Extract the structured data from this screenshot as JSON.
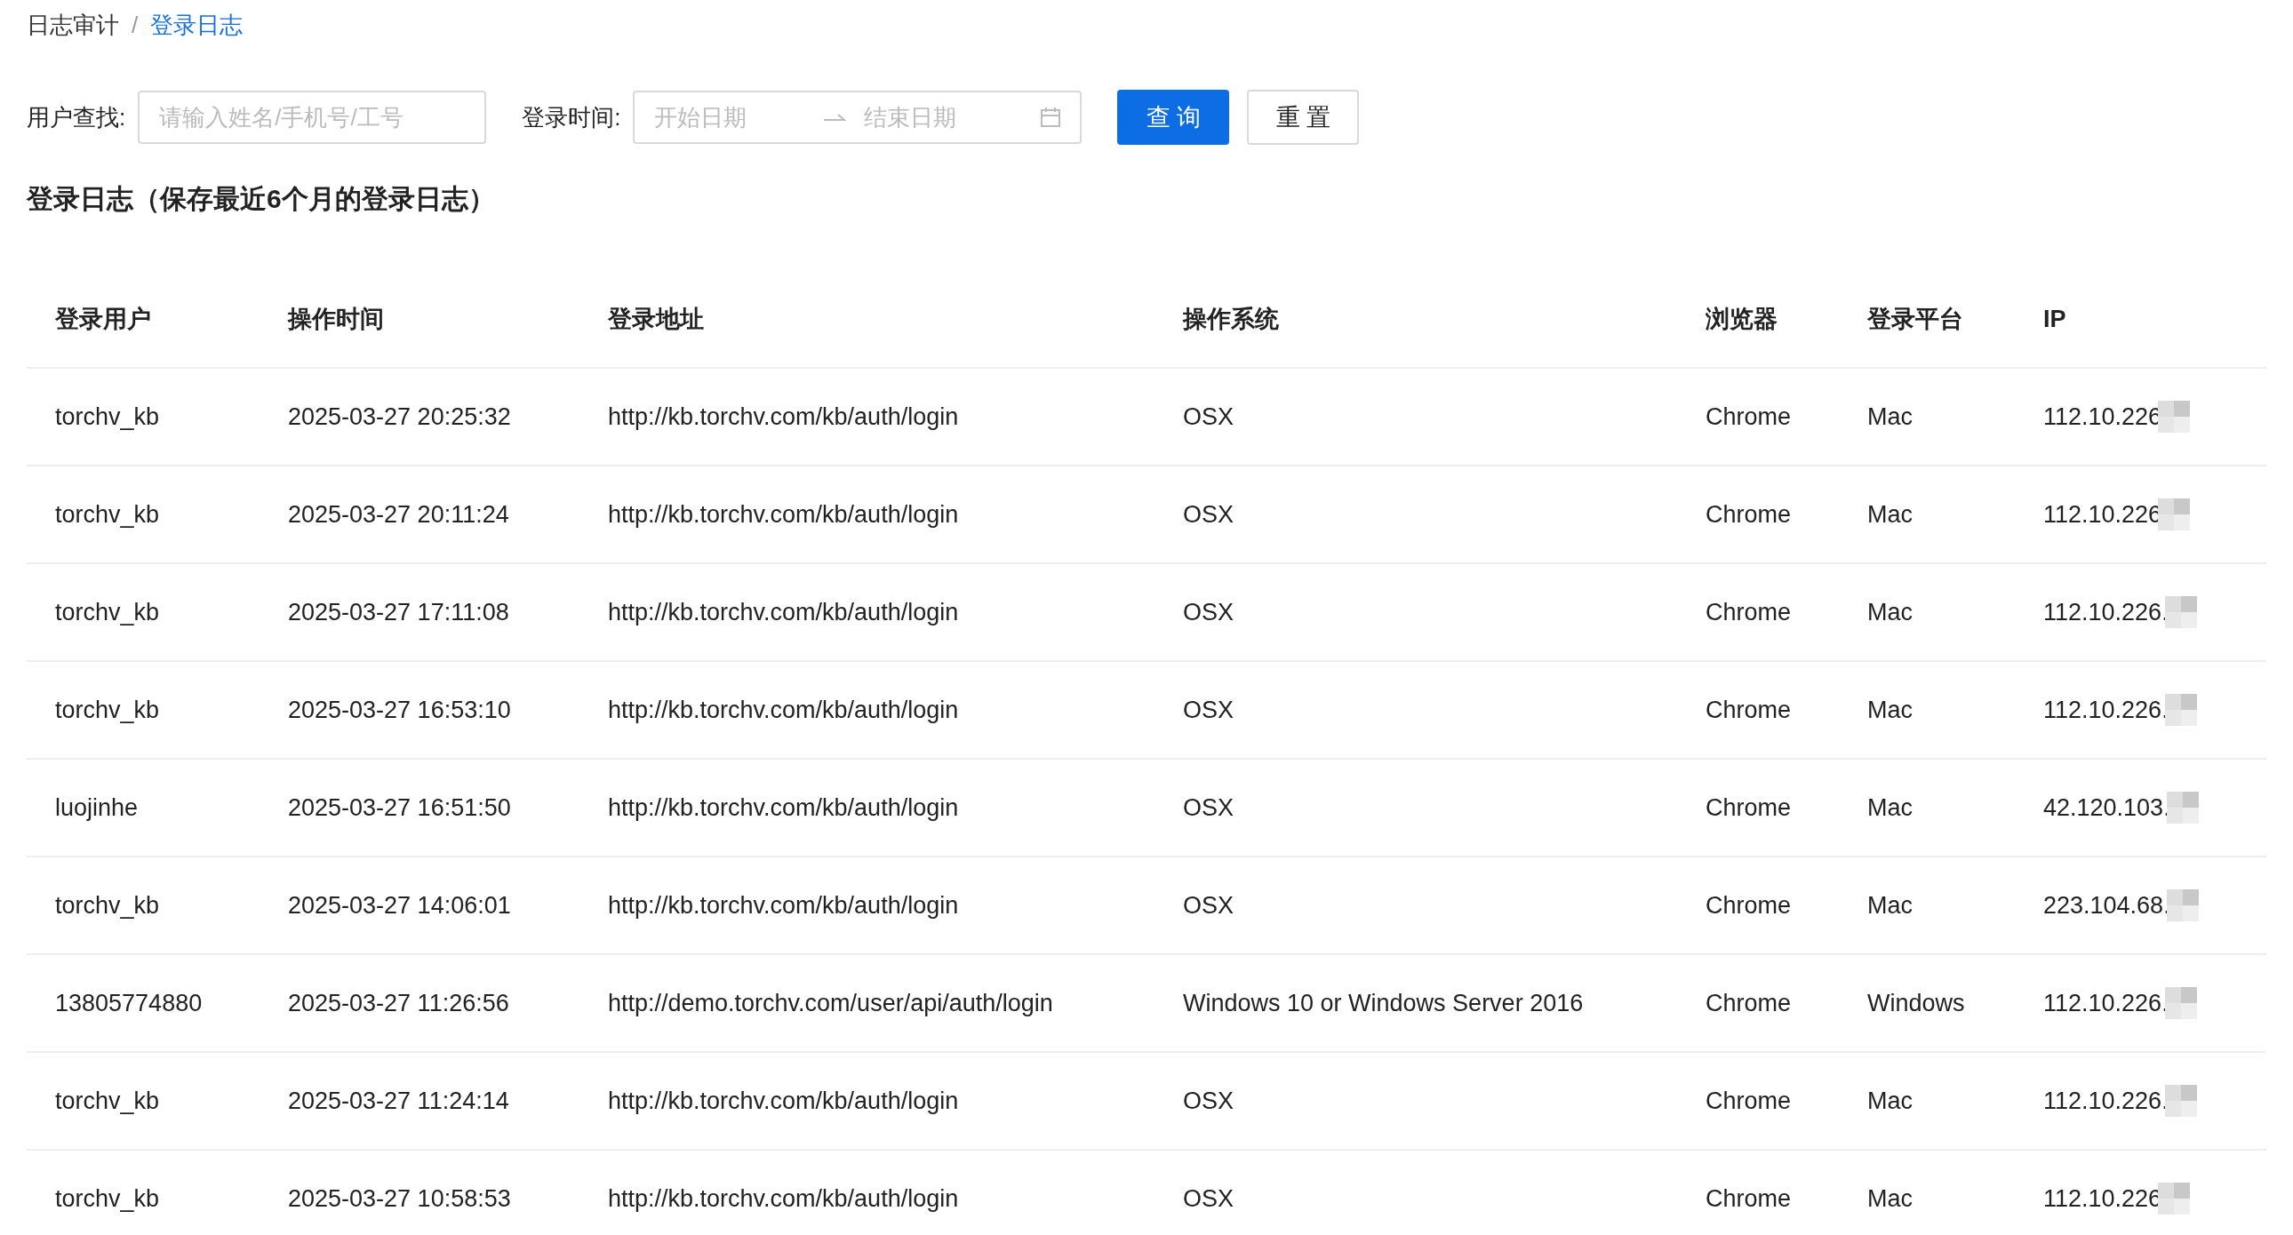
{
  "breadcrumb_separator": "/",
  "breadcrumb": [
    {
      "label": "日志审计",
      "selected": false
    },
    {
      "label": "登录日志",
      "selected": true
    }
  ],
  "filters": {
    "user_label": "用户查找:",
    "user_placeholder": "请输入姓名/手机号/工号",
    "time_label": "登录时间:",
    "start_placeholder": "开始日期",
    "end_placeholder": "结束日期",
    "buttons": [
      {
        "label": "查 询",
        "kind": "primary"
      },
      {
        "label": "重 置",
        "kind": "default"
      }
    ]
  },
  "section_title": "登录日志（保存最近6个月的登录日志）",
  "table": {
    "columns": [
      "登录用户",
      "操作时间",
      "登录地址",
      "操作系统",
      "浏览器",
      "登录平台",
      "IP"
    ],
    "rows": [
      {
        "cells": [
          "torchv_kb",
          "2025-03-27 20:25:32",
          "http://kb.torchv.com/kb/auth/login",
          "OSX",
          "Chrome",
          "Mac",
          "112.10.226"
        ]
      },
      {
        "cells": [
          "torchv_kb",
          "2025-03-27 20:11:24",
          "http://kb.torchv.com/kb/auth/login",
          "OSX",
          "Chrome",
          "Mac",
          "112.10.226"
        ]
      },
      {
        "cells": [
          "torchv_kb",
          "2025-03-27 17:11:08",
          "http://kb.torchv.com/kb/auth/login",
          "OSX",
          "Chrome",
          "Mac",
          "112.10.226."
        ]
      },
      {
        "cells": [
          "torchv_kb",
          "2025-03-27 16:53:10",
          "http://kb.torchv.com/kb/auth/login",
          "OSX",
          "Chrome",
          "Mac",
          "112.10.226."
        ]
      },
      {
        "cells": [
          "luojinhe",
          "2025-03-27 16:51:50",
          "http://kb.torchv.com/kb/auth/login",
          "OSX",
          "Chrome",
          "Mac",
          "42.120.103."
        ]
      },
      {
        "cells": [
          "torchv_kb",
          "2025-03-27 14:06:01",
          "http://kb.torchv.com/kb/auth/login",
          "OSX",
          "Chrome",
          "Mac",
          "223.104.68."
        ]
      },
      {
        "cells": [
          "13805774880",
          "2025-03-27 11:26:56",
          "http://demo.torchv.com/user/api/auth/login",
          "Windows 10 or Windows Server 2016",
          "Chrome",
          "Windows",
          "112.10.226."
        ]
      },
      {
        "cells": [
          "torchv_kb",
          "2025-03-27 11:24:14",
          "http://kb.torchv.com/kb/auth/login",
          "OSX",
          "Chrome",
          "Mac",
          "112.10.226."
        ]
      },
      {
        "cells": [
          "torchv_kb",
          "2025-03-27 10:58:53",
          "http://kb.torchv.com/kb/auth/login",
          "OSX",
          "Chrome",
          "Mac",
          "112.10.226"
        ]
      }
    ]
  }
}
